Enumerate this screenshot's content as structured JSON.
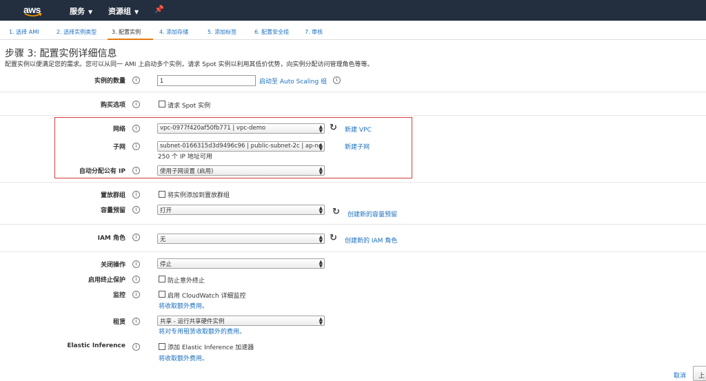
{
  "topnav": {
    "logo_text": "aws",
    "services_label": "服务",
    "resource_groups_label": "资源组",
    "pin_icon": "pin-icon"
  },
  "steps": [
    "1. 选择 AMI",
    "2. 选择实例类型",
    "3. 配置实例",
    "4. 添加存储",
    "5. 添加标签",
    "6. 配置安全组",
    "7. 审核"
  ],
  "page": {
    "title": "步骤 3: 配置实例详细信息",
    "description": "配置实例以便满足您的需求。您可以从同一 AMI 上启动多个实例，请求 Spot 实例以利用其低价优势，向实例分配访问管理角色等等。"
  },
  "form": {
    "instance_count": {
      "label": "实例的数量",
      "value": "1",
      "link": "启动至 Auto Scaling 组"
    },
    "purchase_option": {
      "label": "购买选项",
      "checkbox_label": "请求 Spot 实例"
    },
    "network": {
      "label": "网络",
      "value": "vpc-0977f420af50fb771 | vpc-demo",
      "link": "新建 VPC"
    },
    "subnet": {
      "label": "子网",
      "value": "subnet-0166315d3d9496c96 | public-subnet-2c | ap-nc",
      "note": "250 个 IP 地址可用",
      "link": "新建子网"
    },
    "auto_public_ip": {
      "label": "自动分配公有 IP",
      "value": "使用子网设置 (启用)"
    },
    "placement_group": {
      "label": "置放群组",
      "checkbox_label": "将实例添加到置放群组"
    },
    "capacity_reservation": {
      "label": "容量预留",
      "value": "打开",
      "link": "创建新的容量预留"
    },
    "iam_role": {
      "label": "IAM 角色",
      "value": "无",
      "link": "创建新的 IAM 角色"
    },
    "shutdown_behavior": {
      "label": "关闭操作",
      "value": "停止"
    },
    "termination_protection": {
      "label": "启用终止保护",
      "checkbox_label": "防止意外终止"
    },
    "monitoring": {
      "label": "监控",
      "checkbox_label": "启用 CloudWatch 详细监控",
      "note": "将收取额外费用。"
    },
    "tenancy": {
      "label": "租赁",
      "value": "共享 - 运行共享硬件实例",
      "note": "将对专用租赁收取额外的费用。"
    },
    "elastic_inference": {
      "label": "Elastic Inference",
      "checkbox_label": "添加 Elastic Inference 加速器",
      "note": "将收取额外费用。"
    }
  },
  "footer": {
    "cancel_label": "取消",
    "prev_label": "上"
  },
  "colors": {
    "nav_bg": "#232f3e",
    "link": "#1a6fbf",
    "active_step": "#e47911",
    "highlight_box": "#d63b3b"
  }
}
